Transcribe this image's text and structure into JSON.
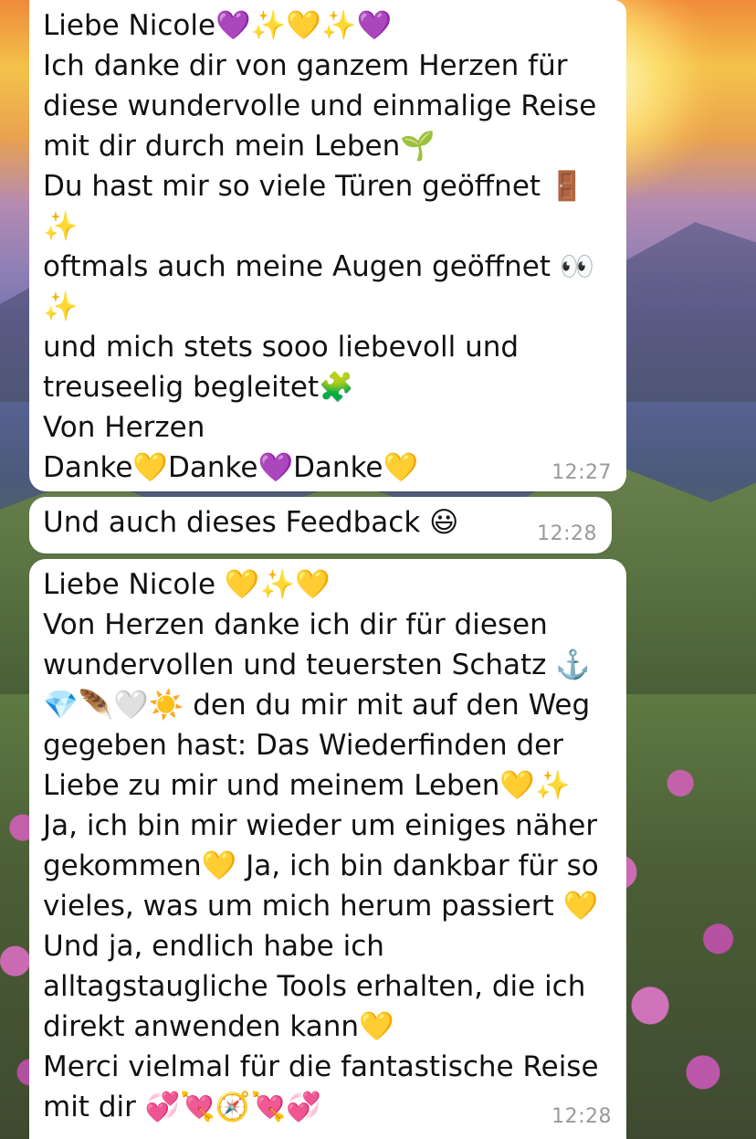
{
  "messages": [
    {
      "text": "Liebe Nicole💜✨💛✨💜\nIch danke dir von ganzem Herzen für diese wundervolle und einmalige Reise mit dir durch mein Leben🌱\nDu hast mir so viele Türen geöffnet 🚪✨\noftmals auch meine Augen geöffnet 👀✨\nund mich stets sooo liebevoll und treuseelig begleitet🧩\nVon Herzen\nDanke💛Danke💜Danke💛",
      "time": "12:27"
    },
    {
      "text": "Und auch dieses Feedback 😃",
      "time": "12:28"
    },
    {
      "text": "Liebe Nicole 💛✨💛\nVon Herzen danke ich dir für diesen wundervollen und teuersten Schatz ⚓️💎🪶🤍☀️ den du mir mit auf den Weg gegeben hast: Das Wiederfinden der Liebe zu mir und meinem Leben💛✨\nJa, ich bin mir wieder um einiges näher gekommen💛 Ja, ich bin dankbar für so vieles, was um mich herum passiert 💛\nUnd ja, endlich habe ich alltagstaugliche Tools erhalten, die ich direkt anwenden kann💛\nMerci vielmal für die fantastische Reise mit dir 💞💘🧭💘💞",
      "time": "12:28"
    }
  ]
}
